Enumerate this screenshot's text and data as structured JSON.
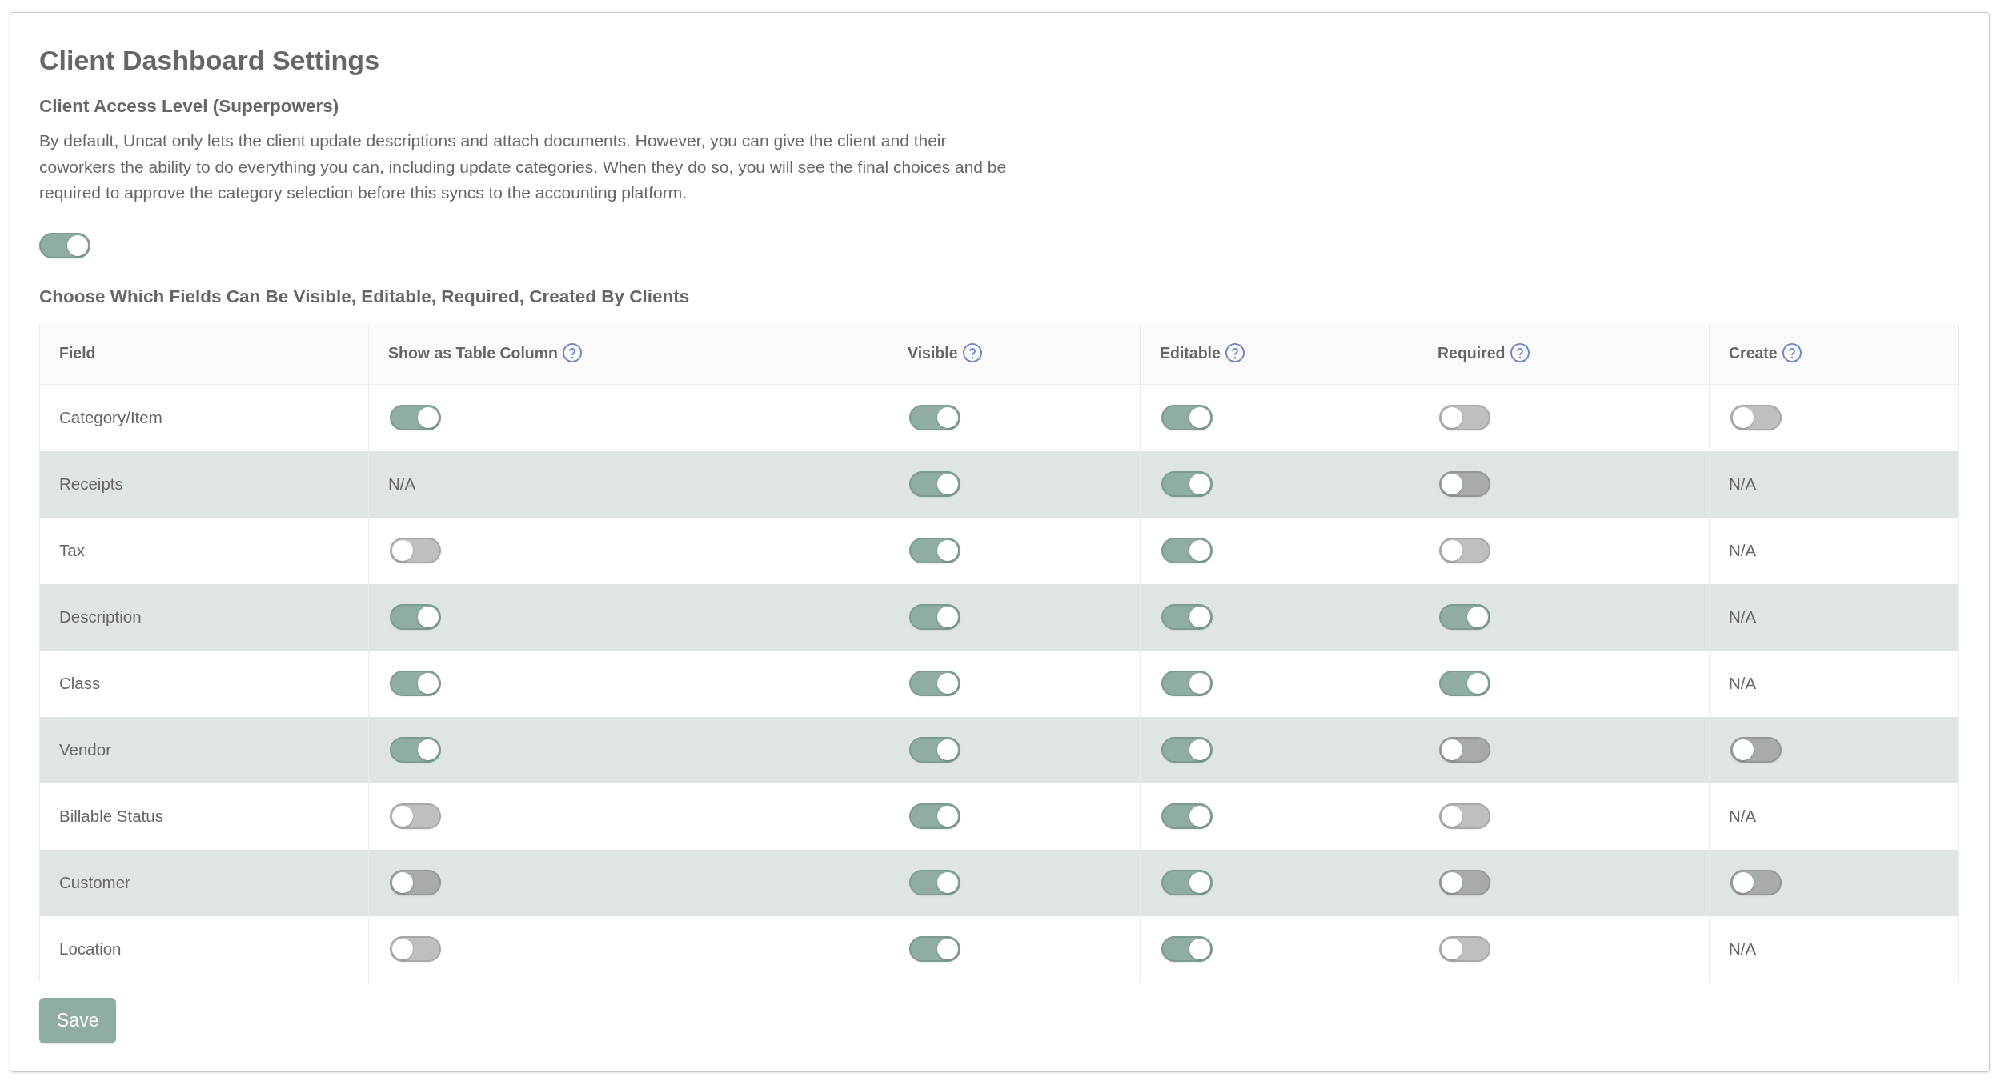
{
  "page": {
    "title": "Client Dashboard Settings"
  },
  "access_level": {
    "heading": "Client Access Level (Superpowers)",
    "description": "By default, Uncat only lets the client update descriptions and attach documents. However, you can give the client and their coworkers the ability to do everything you can, including update categories. When they do so, you will see the final choices and be required to approve the category selection before this syncs to the accounting platform.",
    "toggle": {
      "on": true
    }
  },
  "fields_section": {
    "heading": "Choose Which Fields Can Be Visible, Editable, Required, Created By Clients"
  },
  "table": {
    "columns": [
      {
        "label": "Field",
        "help": false
      },
      {
        "label": "Show as Table Column",
        "help": true
      },
      {
        "label": "Visible",
        "help": true
      },
      {
        "label": "Editable",
        "help": true
      },
      {
        "label": "Required",
        "help": true
      },
      {
        "label": "Create",
        "help": true
      }
    ],
    "rows": [
      {
        "cells": [
          {
            "kind": "text",
            "text": "Category/Item"
          },
          {
            "kind": "toggle",
            "on": true
          },
          {
            "kind": "toggle",
            "on": true
          },
          {
            "kind": "toggle",
            "on": true
          },
          {
            "kind": "toggle",
            "on": false
          },
          {
            "kind": "toggle",
            "on": false
          }
        ]
      },
      {
        "cells": [
          {
            "kind": "text",
            "text": "Receipts"
          },
          {
            "kind": "text",
            "text": "N/A"
          },
          {
            "kind": "toggle",
            "on": true
          },
          {
            "kind": "toggle",
            "on": true
          },
          {
            "kind": "toggle",
            "on": false
          },
          {
            "kind": "text",
            "text": "N/A"
          }
        ]
      },
      {
        "cells": [
          {
            "kind": "text",
            "text": "Tax"
          },
          {
            "kind": "toggle",
            "on": false
          },
          {
            "kind": "toggle",
            "on": true
          },
          {
            "kind": "toggle",
            "on": true
          },
          {
            "kind": "toggle",
            "on": false
          },
          {
            "kind": "text",
            "text": "N/A"
          }
        ]
      },
      {
        "cells": [
          {
            "kind": "text",
            "text": "Description"
          },
          {
            "kind": "toggle",
            "on": true
          },
          {
            "kind": "toggle",
            "on": true
          },
          {
            "kind": "toggle",
            "on": true
          },
          {
            "kind": "toggle",
            "on": true
          },
          {
            "kind": "text",
            "text": "N/A"
          }
        ]
      },
      {
        "cells": [
          {
            "kind": "text",
            "text": "Class"
          },
          {
            "kind": "toggle",
            "on": true
          },
          {
            "kind": "toggle",
            "on": true
          },
          {
            "kind": "toggle",
            "on": true
          },
          {
            "kind": "toggle",
            "on": true
          },
          {
            "kind": "text",
            "text": "N/A"
          }
        ]
      },
      {
        "cells": [
          {
            "kind": "text",
            "text": "Vendor"
          },
          {
            "kind": "toggle",
            "on": true
          },
          {
            "kind": "toggle",
            "on": true
          },
          {
            "kind": "toggle",
            "on": true
          },
          {
            "kind": "toggle",
            "on": false
          },
          {
            "kind": "toggle",
            "on": false
          }
        ]
      },
      {
        "cells": [
          {
            "kind": "text",
            "text": "Billable Status"
          },
          {
            "kind": "toggle",
            "on": false
          },
          {
            "kind": "toggle",
            "on": true
          },
          {
            "kind": "toggle",
            "on": true
          },
          {
            "kind": "toggle",
            "on": false
          },
          {
            "kind": "text",
            "text": "N/A"
          }
        ]
      },
      {
        "cells": [
          {
            "kind": "text",
            "text": "Customer"
          },
          {
            "kind": "toggle",
            "on": false
          },
          {
            "kind": "toggle",
            "on": true
          },
          {
            "kind": "toggle",
            "on": true
          },
          {
            "kind": "toggle",
            "on": false
          },
          {
            "kind": "toggle",
            "on": false
          }
        ]
      },
      {
        "cells": [
          {
            "kind": "text",
            "text": "Location"
          },
          {
            "kind": "toggle",
            "on": false
          },
          {
            "kind": "toggle",
            "on": true
          },
          {
            "kind": "toggle",
            "on": true
          },
          {
            "kind": "toggle",
            "on": false
          },
          {
            "kind": "text",
            "text": "N/A"
          }
        ]
      }
    ]
  },
  "save_button": {
    "label": "Save"
  }
}
